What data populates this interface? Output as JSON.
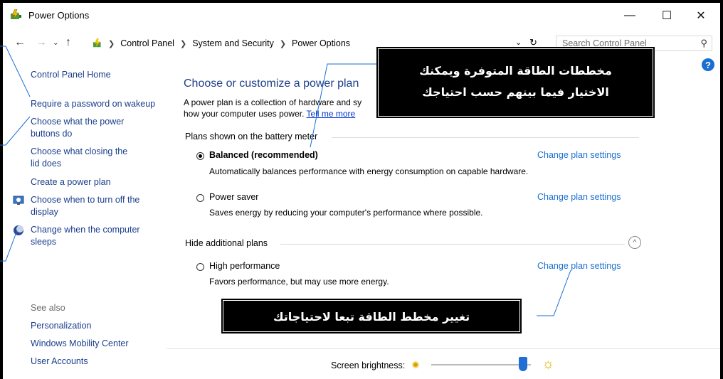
{
  "window": {
    "title": "Power Options",
    "controls": [
      "minimize-icon",
      "maximize-icon",
      "close-icon"
    ]
  },
  "address": {
    "segments": [
      "Control Panel",
      "System and Security",
      "Power Options"
    ],
    "search_placeholder": "Search Control Panel"
  },
  "sidebar": {
    "home": "Control Panel Home",
    "items": [
      "Require a password on wakeup",
      "Choose what the power buttons do",
      "Choose what closing the lid does",
      "Create a power plan",
      "Choose when to turn off the display",
      "Change when the computer sleeps"
    ],
    "see_also": "See also",
    "see_also_links": [
      "Personalization",
      "Windows Mobility Center",
      "User Accounts"
    ]
  },
  "main": {
    "title": "Choose or customize a power plan",
    "desc_line1": "A power plan is a collection of hardware and sy",
    "desc_line2": "how your computer uses power.",
    "desc_link": "Tell me more",
    "section_battery": "Plans shown on the battery meter",
    "section_hide": "Hide additional plans",
    "change_link": "Change plan settings",
    "plans": [
      {
        "name": "Balanced (recommended)",
        "desc": "Automatically balances performance with energy consumption on capable hardware.",
        "selected": true
      },
      {
        "name": "Power saver",
        "desc": "Saves energy by reducing your computer's performance where possible.",
        "selected": false
      },
      {
        "name": "High performance",
        "desc": "Favors performance, but may use more energy.",
        "selected": false
      }
    ],
    "brightness_label": "Screen brightness:",
    "brightness_level": 0.95
  },
  "callouts": {
    "plans_line1": "مخططات الطاقة المتوفرة ويمكنك",
    "plans_line2": "الاختيار فيما بينهم حسب احتياجك",
    "change": "تغيير مخطط الطاقة تبعا لاحتياجاتك"
  },
  "colors": {
    "link": "#1a6fd1",
    "sidebar_link": "#1a3e8c",
    "title": "#1e3f8a",
    "callout_bg": "#000000",
    "annotation_line": "#1a6fd1"
  }
}
